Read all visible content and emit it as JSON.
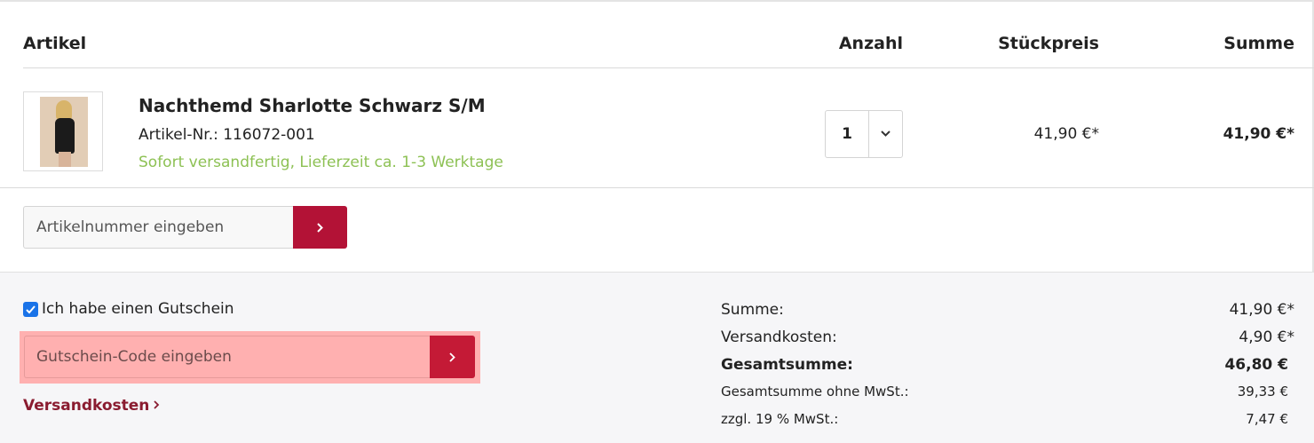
{
  "table_header": {
    "artikel": "Artikel",
    "anzahl": "Anzahl",
    "stueckpreis": "Stückpreis",
    "summe": "Summe"
  },
  "item": {
    "name": "Nachthemd Sharlotte Schwarz S/M",
    "article_number": "Artikel-Nr.: 116072-001",
    "delivery": "Sofort versandfertig, Lieferzeit ca. 1-3 Werktage",
    "quantity": "1",
    "unit_price": "41,90 €*",
    "total": "41,90 €*"
  },
  "add_article": {
    "placeholder": "Artikelnummer eingeben"
  },
  "voucher": {
    "checkbox_label": "Ich habe einen Gutschein",
    "checked": true,
    "placeholder": "Gutschein-Code eingeben"
  },
  "shipping_link": "Versandkosten",
  "summary": [
    {
      "label": "Summe:",
      "value": "41,90 €*",
      "style": "normal"
    },
    {
      "label": "Versandkosten:",
      "value": "4,90 €*",
      "style": "normal"
    },
    {
      "label": "Gesamtsumme:",
      "value": "46,80 €",
      "style": "bold"
    },
    {
      "label": "Gesamtsumme ohne MwSt.:",
      "value": "39,33 €",
      "style": "small"
    },
    {
      "label": "zzgl. 19 % MwSt.:",
      "value": "7,47 €",
      "style": "small"
    }
  ],
  "colors": {
    "accent": "#b31236",
    "delivery_green": "#8dc154",
    "link": "#8a1c30",
    "highlight": "#ffb0b0"
  },
  "icons": {
    "quantity_dropdown": "chevron-down-icon",
    "submit": "chevron-right-icon",
    "link_arrow": "chevron-right-icon",
    "checkbox": "check-icon"
  }
}
